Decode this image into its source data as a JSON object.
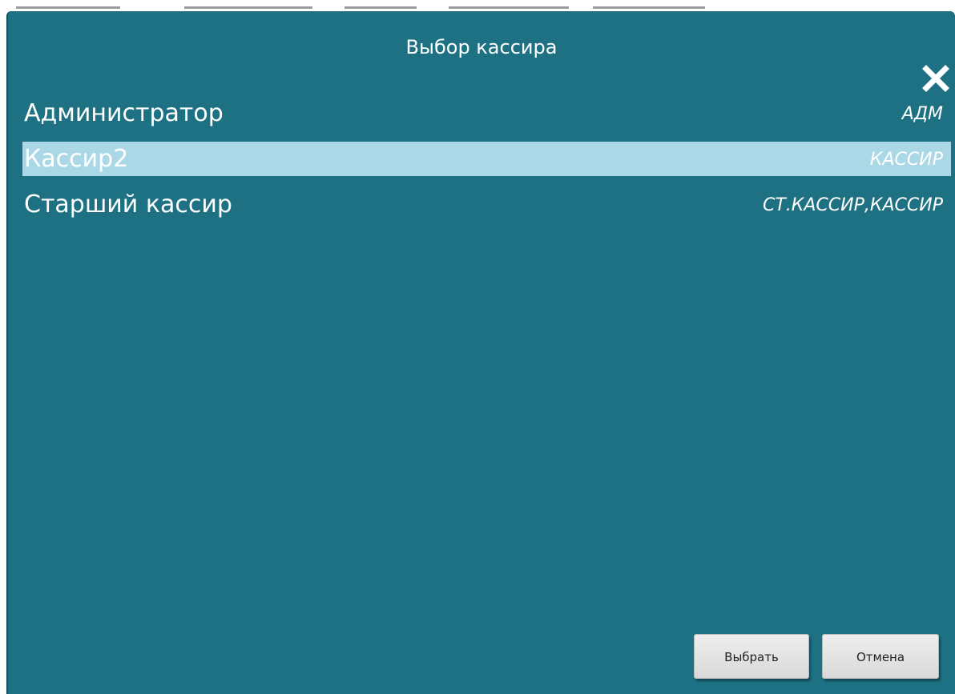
{
  "dialog": {
    "title": "Выбор кассира",
    "close_label": "X"
  },
  "cashiers": [
    {
      "name": "Администратор",
      "role": "АДМ",
      "selected": false
    },
    {
      "name": "Кассир2",
      "role": "КАССИР",
      "selected": true
    },
    {
      "name": "Старший кассир",
      "role": "СТ.КАССИР,КАССИР",
      "selected": false
    }
  ],
  "buttons": {
    "select_label": "Выбрать",
    "cancel_label": "Отмена"
  },
  "colors": {
    "dialog_bg": "#1d7183",
    "selected_row_bg": "#abd8e6",
    "text": "#ffffff"
  }
}
